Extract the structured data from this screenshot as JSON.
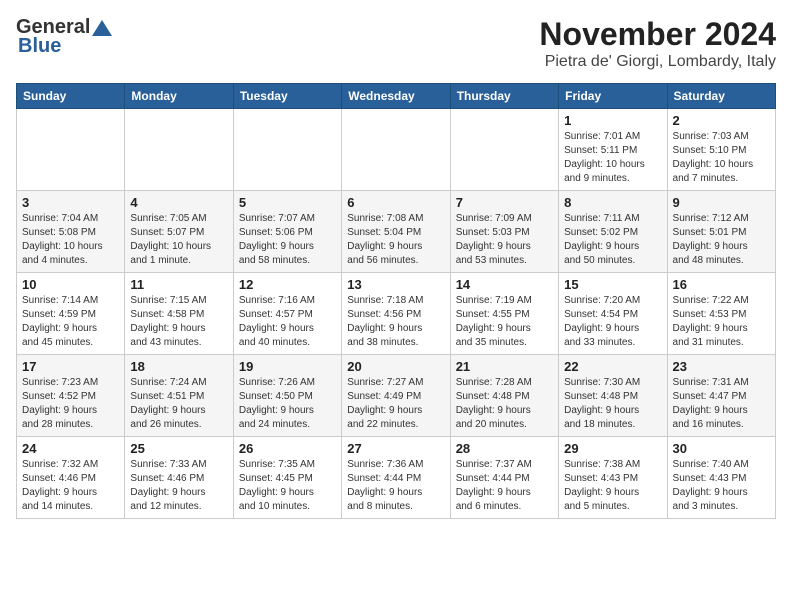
{
  "header": {
    "logo_general": "General",
    "logo_blue": "Blue",
    "month_title": "November 2024",
    "location": "Pietra de' Giorgi, Lombardy, Italy"
  },
  "weekdays": [
    "Sunday",
    "Monday",
    "Tuesday",
    "Wednesday",
    "Thursday",
    "Friday",
    "Saturday"
  ],
  "weeks": [
    [
      {
        "day": "",
        "info": ""
      },
      {
        "day": "",
        "info": ""
      },
      {
        "day": "",
        "info": ""
      },
      {
        "day": "",
        "info": ""
      },
      {
        "day": "",
        "info": ""
      },
      {
        "day": "1",
        "info": "Sunrise: 7:01 AM\nSunset: 5:11 PM\nDaylight: 10 hours\nand 9 minutes."
      },
      {
        "day": "2",
        "info": "Sunrise: 7:03 AM\nSunset: 5:10 PM\nDaylight: 10 hours\nand 7 minutes."
      }
    ],
    [
      {
        "day": "3",
        "info": "Sunrise: 7:04 AM\nSunset: 5:08 PM\nDaylight: 10 hours\nand 4 minutes."
      },
      {
        "day": "4",
        "info": "Sunrise: 7:05 AM\nSunset: 5:07 PM\nDaylight: 10 hours\nand 1 minute."
      },
      {
        "day": "5",
        "info": "Sunrise: 7:07 AM\nSunset: 5:06 PM\nDaylight: 9 hours\nand 58 minutes."
      },
      {
        "day": "6",
        "info": "Sunrise: 7:08 AM\nSunset: 5:04 PM\nDaylight: 9 hours\nand 56 minutes."
      },
      {
        "day": "7",
        "info": "Sunrise: 7:09 AM\nSunset: 5:03 PM\nDaylight: 9 hours\nand 53 minutes."
      },
      {
        "day": "8",
        "info": "Sunrise: 7:11 AM\nSunset: 5:02 PM\nDaylight: 9 hours\nand 50 minutes."
      },
      {
        "day": "9",
        "info": "Sunrise: 7:12 AM\nSunset: 5:01 PM\nDaylight: 9 hours\nand 48 minutes."
      }
    ],
    [
      {
        "day": "10",
        "info": "Sunrise: 7:14 AM\nSunset: 4:59 PM\nDaylight: 9 hours\nand 45 minutes."
      },
      {
        "day": "11",
        "info": "Sunrise: 7:15 AM\nSunset: 4:58 PM\nDaylight: 9 hours\nand 43 minutes."
      },
      {
        "day": "12",
        "info": "Sunrise: 7:16 AM\nSunset: 4:57 PM\nDaylight: 9 hours\nand 40 minutes."
      },
      {
        "day": "13",
        "info": "Sunrise: 7:18 AM\nSunset: 4:56 PM\nDaylight: 9 hours\nand 38 minutes."
      },
      {
        "day": "14",
        "info": "Sunrise: 7:19 AM\nSunset: 4:55 PM\nDaylight: 9 hours\nand 35 minutes."
      },
      {
        "day": "15",
        "info": "Sunrise: 7:20 AM\nSunset: 4:54 PM\nDaylight: 9 hours\nand 33 minutes."
      },
      {
        "day": "16",
        "info": "Sunrise: 7:22 AM\nSunset: 4:53 PM\nDaylight: 9 hours\nand 31 minutes."
      }
    ],
    [
      {
        "day": "17",
        "info": "Sunrise: 7:23 AM\nSunset: 4:52 PM\nDaylight: 9 hours\nand 28 minutes."
      },
      {
        "day": "18",
        "info": "Sunrise: 7:24 AM\nSunset: 4:51 PM\nDaylight: 9 hours\nand 26 minutes."
      },
      {
        "day": "19",
        "info": "Sunrise: 7:26 AM\nSunset: 4:50 PM\nDaylight: 9 hours\nand 24 minutes."
      },
      {
        "day": "20",
        "info": "Sunrise: 7:27 AM\nSunset: 4:49 PM\nDaylight: 9 hours\nand 22 minutes."
      },
      {
        "day": "21",
        "info": "Sunrise: 7:28 AM\nSunset: 4:48 PM\nDaylight: 9 hours\nand 20 minutes."
      },
      {
        "day": "22",
        "info": "Sunrise: 7:30 AM\nSunset: 4:48 PM\nDaylight: 9 hours\nand 18 minutes."
      },
      {
        "day": "23",
        "info": "Sunrise: 7:31 AM\nSunset: 4:47 PM\nDaylight: 9 hours\nand 16 minutes."
      }
    ],
    [
      {
        "day": "24",
        "info": "Sunrise: 7:32 AM\nSunset: 4:46 PM\nDaylight: 9 hours\nand 14 minutes."
      },
      {
        "day": "25",
        "info": "Sunrise: 7:33 AM\nSunset: 4:46 PM\nDaylight: 9 hours\nand 12 minutes."
      },
      {
        "day": "26",
        "info": "Sunrise: 7:35 AM\nSunset: 4:45 PM\nDaylight: 9 hours\nand 10 minutes."
      },
      {
        "day": "27",
        "info": "Sunrise: 7:36 AM\nSunset: 4:44 PM\nDaylight: 9 hours\nand 8 minutes."
      },
      {
        "day": "28",
        "info": "Sunrise: 7:37 AM\nSunset: 4:44 PM\nDaylight: 9 hours\nand 6 minutes."
      },
      {
        "day": "29",
        "info": "Sunrise: 7:38 AM\nSunset: 4:43 PM\nDaylight: 9 hours\nand 5 minutes."
      },
      {
        "day": "30",
        "info": "Sunrise: 7:40 AM\nSunset: 4:43 PM\nDaylight: 9 hours\nand 3 minutes."
      }
    ]
  ]
}
